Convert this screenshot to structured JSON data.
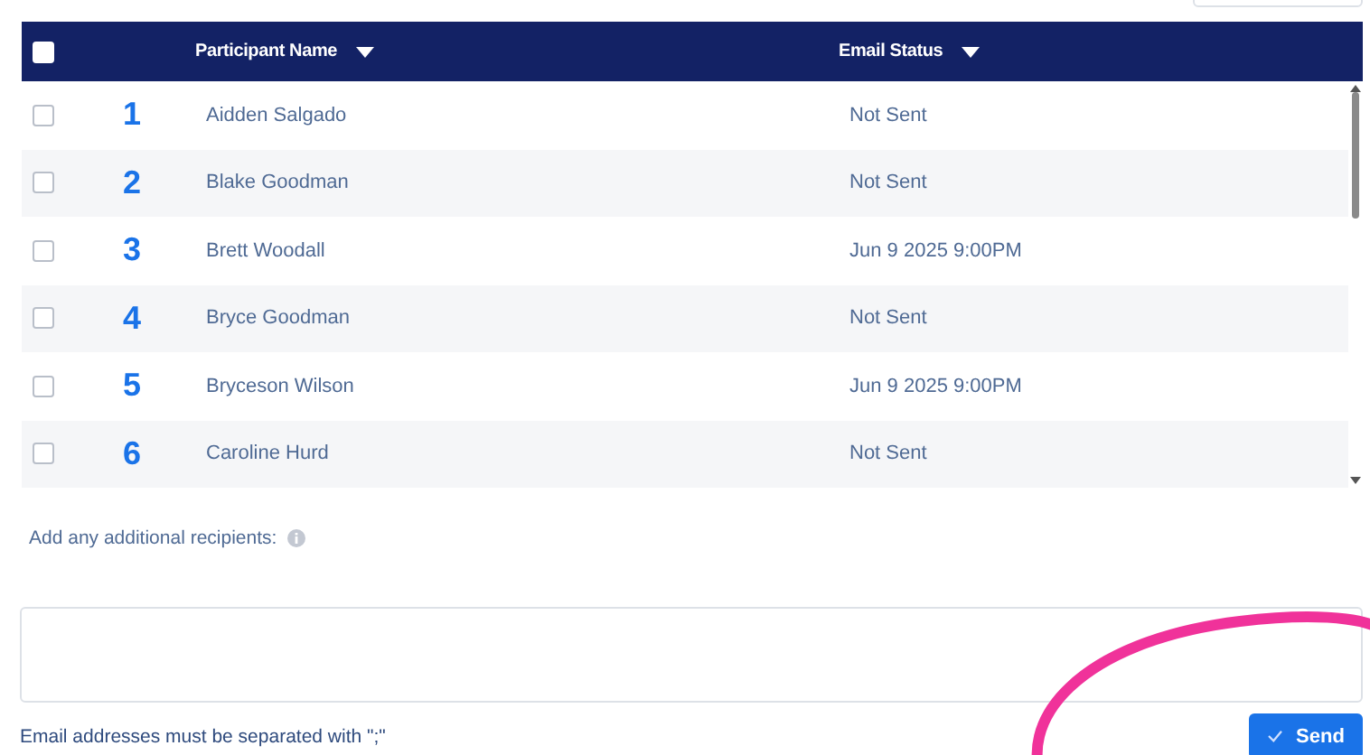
{
  "table": {
    "select_all": {
      "checked": false
    },
    "columns": [
      {
        "label": "Participant Name"
      },
      {
        "label": "Email Status"
      }
    ],
    "rows": [
      {
        "number": "1",
        "name": "Aidden Salgado",
        "status": "Not Sent",
        "checked": false
      },
      {
        "number": "2",
        "name": "Blake Goodman",
        "status": "Not Sent",
        "checked": false
      },
      {
        "number": "3",
        "name": "Brett Woodall",
        "status": "Jun 9 2025 9:00PM",
        "checked": false
      },
      {
        "number": "4",
        "name": "Bryce Goodman",
        "status": "Not Sent",
        "checked": false
      },
      {
        "number": "5",
        "name": "Bryceson Wilson",
        "status": "Jun 9 2025 9:00PM",
        "checked": false
      },
      {
        "number": "6",
        "name": "Caroline Hurd",
        "status": "Not Sent",
        "checked": false
      }
    ]
  },
  "recipients": {
    "label": "Add any additional recipients:",
    "hint": "Email addresses must be separated with \";\""
  },
  "send_button": {
    "label": "Send"
  }
}
